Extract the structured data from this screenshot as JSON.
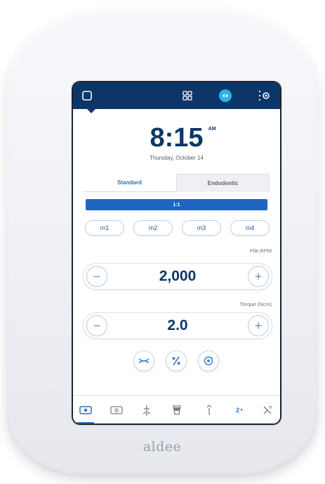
{
  "brand": {
    "logo_text": "aldee"
  },
  "status": {
    "time": "8:15",
    "ampm": "AM",
    "date": "Thursday, October 14"
  },
  "tabs": [
    {
      "label": "Standard",
      "selected": true
    },
    {
      "label": "Endodontic",
      "selected": false
    }
  ],
  "ratio": {
    "label": "1:1"
  },
  "presets": [
    "m1",
    "m2",
    "m3",
    "m4"
  ],
  "file_rpm": {
    "label": "File RPM",
    "value": "2,000",
    "minus": "−",
    "plus": "+"
  },
  "torque": {
    "label": "Torque (Ncm)",
    "value": "2.0",
    "minus": "−",
    "plus": "+"
  },
  "bottom_nav": {
    "item6_text": "2",
    "active_index": 0
  },
  "colors": {
    "topbar": "#0c3568",
    "accent": "#1f66c2",
    "value_text": "#0d3766",
    "teal_status": "#2bb4e8"
  },
  "icons": {
    "topbar": [
      "screen-icon",
      "grid-icon",
      "status-indicator-icon",
      "settings-icon"
    ],
    "modes": [
      "reverse-mode-icon",
      "percent-mode-icon",
      "auto-reverse-icon"
    ],
    "bottom": [
      "motor-icon",
      "handpiece-icon",
      "chair-icon",
      "cup-icon",
      "light-icon",
      "counter-icon",
      "tools-icon"
    ]
  }
}
